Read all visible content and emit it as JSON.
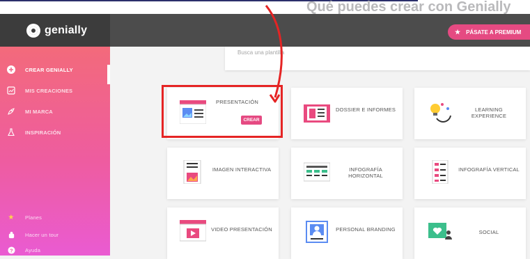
{
  "background_heading": "Qué puedes crear con Genially",
  "header": {
    "logo_text": "genially",
    "premium_button": "PÁSATE A PREMIUM",
    "brand_color": "#e54a82"
  },
  "search": {
    "placeholder": "Busca una plantilla"
  },
  "sidebar": {
    "items": [
      {
        "label": "CREAR GENIALLY",
        "icon": "plus-circle-icon",
        "active": true
      },
      {
        "label": "MIS CREACIONES",
        "icon": "chart-card-icon",
        "active": false
      },
      {
        "label": "MI MARCA",
        "icon": "rocket-icon",
        "active": false
      },
      {
        "label": "INSPIRACIÓN",
        "icon": "flask-icon",
        "active": false
      }
    ],
    "bottom_items": [
      {
        "label": "Planes",
        "icon": "star-icon"
      },
      {
        "label": "Hacer un tour",
        "icon": "compass-icon"
      },
      {
        "label": "Ayuda",
        "icon": "question-icon"
      }
    ]
  },
  "cards": [
    {
      "label": "PRESENTACIÓN",
      "action": "CREAR",
      "icon": "presentation-icon",
      "highlighted": true
    },
    {
      "label": "DOSSIER E INFORMES",
      "icon": "dossier-icon"
    },
    {
      "label": "LEARNING EXPERIENCE",
      "icon": "lightbulb-icon"
    },
    {
      "label": "IMAGEN INTERACTIVA",
      "icon": "interactive-image-icon"
    },
    {
      "label": "INFOGRAFÍA HORIZONTAL",
      "icon": "horizontal-infographic-icon"
    },
    {
      "label": "INFOGRAFÍA VERTICAL",
      "icon": "vertical-infographic-icon"
    },
    {
      "label": "VIDEO PRESENTACIÓN",
      "icon": "video-presentation-icon"
    },
    {
      "label": "PERSONAL BRANDING",
      "icon": "personal-branding-icon"
    },
    {
      "label": "SOCIAL",
      "icon": "social-icon"
    }
  ],
  "annotation_color": "#e52424"
}
